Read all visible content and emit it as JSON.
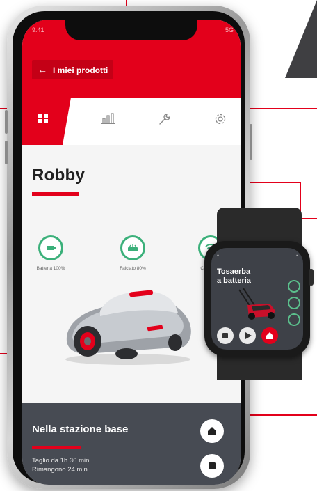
{
  "header": {
    "back_label": "I miei prodotti",
    "status_left": "9:41",
    "status_right": "5G"
  },
  "tabs": [
    {
      "icon": "grid-icon",
      "active": true
    },
    {
      "icon": "bar-chart-icon",
      "active": false
    },
    {
      "icon": "wrench-icon",
      "active": false
    },
    {
      "icon": "gear-icon",
      "active": false
    }
  ],
  "product": {
    "name": "Robby",
    "stats": [
      {
        "icon": "battery-icon",
        "label": "Batteria 100%"
      },
      {
        "icon": "blade-icon",
        "label": "Falciato 80%"
      },
      {
        "icon": "wifi-icon",
        "label": "Connesso"
      }
    ]
  },
  "status_panel": {
    "title": "Nella stazione base",
    "line1": "Taglio da 1h 36 min",
    "line2": "Rimangono 24 min"
  },
  "watch": {
    "title_line1": "Tosaerba",
    "title_line2": "a batteria"
  },
  "colors": {
    "brand_red": "#e3001b",
    "panel_dark": "#474b53",
    "status_green": "#3bb07a"
  }
}
